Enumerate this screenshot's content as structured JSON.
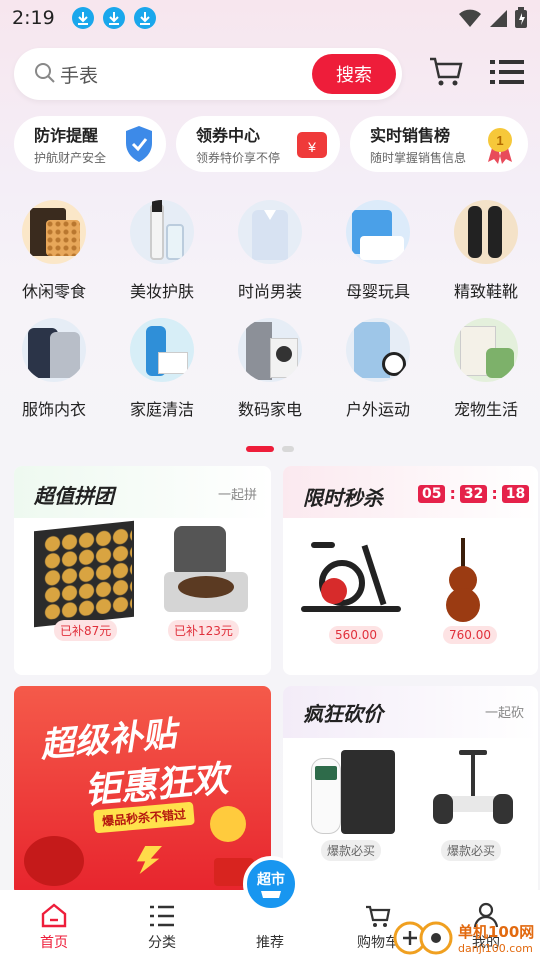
{
  "status": {
    "time": "2:19"
  },
  "search": {
    "query": "手表",
    "button": "搜索"
  },
  "promos": [
    {
      "title": "防诈提醒",
      "sub": "护航财产安全"
    },
    {
      "title": "领券中心",
      "sub": "领券特价享不停"
    },
    {
      "title": "实时销售榜",
      "sub": "随时掌握销售信息"
    }
  ],
  "categories": [
    "休闲零食",
    "美妆护肤",
    "时尚男装",
    "母婴玩具",
    "精致鞋靴",
    "服饰内衣",
    "家庭清洁",
    "数码家电",
    "户外运动",
    "宠物生活"
  ],
  "groupbuy": {
    "title": "超值拼团",
    "more": "一起拼",
    "items": [
      {
        "price": "已补87元"
      },
      {
        "price": "已补123元"
      }
    ]
  },
  "flash": {
    "title": "限时秒杀",
    "timer": [
      "05",
      "32",
      "18"
    ],
    "items": [
      {
        "price": "560.00"
      },
      {
        "price": "760.00"
      }
    ]
  },
  "subsidy": {
    "big": "超级补贴",
    "big2": "钜惠狂欢",
    "tag": "爆品秒杀不错过"
  },
  "bargain": {
    "title": "疯狂砍价",
    "more": "一起砍",
    "items": [
      {
        "price": "爆款必买"
      },
      {
        "price": "爆款必买"
      }
    ]
  },
  "tabbar": {
    "home": "首页",
    "category": "分类",
    "recommend": "推荐",
    "cart": "购物车",
    "mine": "我的",
    "bubble": "超市"
  },
  "watermark": {
    "name": "单机100网",
    "url": "danji100.com"
  }
}
